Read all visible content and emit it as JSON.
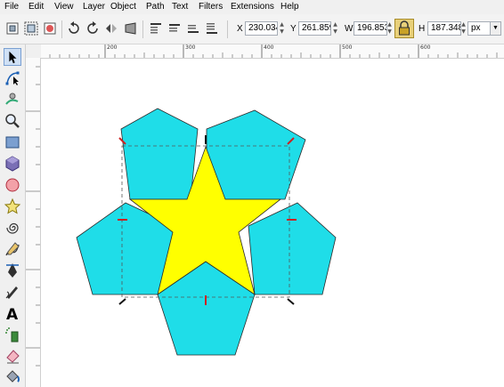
{
  "menu": [
    {
      "label": "File",
      "name": "menu-file"
    },
    {
      "label": "Edit",
      "name": "menu-edit"
    },
    {
      "label": "View",
      "name": "menu-view"
    },
    {
      "label": "Layer",
      "name": "menu-layer"
    },
    {
      "label": "Object",
      "name": "menu-object"
    },
    {
      "label": "Path",
      "name": "menu-path"
    },
    {
      "label": "Text",
      "name": "menu-text"
    },
    {
      "label": "Filters",
      "name": "menu-filters"
    },
    {
      "label": "Extensions",
      "name": "menu-extensions"
    },
    {
      "label": "Help",
      "name": "menu-help"
    }
  ],
  "toolbar": {
    "x_label": "X",
    "x_value": "230.034",
    "y_label": "Y",
    "y_value": "261.859",
    "w_label": "W",
    "w_value": "196.853",
    "h_label": "H",
    "h_value": "187.348",
    "unit": "px",
    "lock_icon": "lock-icon"
  },
  "ruler": {
    "ticks": [
      "200",
      "300",
      "400",
      "500",
      "600"
    ]
  },
  "canvas": {
    "pentagon_color": "#1fdde8",
    "star_color": "#ffff00",
    "handle_color_top": "#cc2222"
  },
  "tools": [
    "selector-arrow-icon",
    "node-tool-icon",
    "tweak-tool-icon",
    "zoom-tool-icon",
    "rectangle-tool-icon",
    "box3d-tool-icon",
    "ellipse-tool-icon",
    "star-tool-icon",
    "spiral-tool-icon",
    "pencil-tool-icon",
    "pen-tool-icon",
    "calligraphy-tool-icon",
    "text-tool-icon",
    "spray-tool-icon",
    "eraser-tool-icon",
    "paint-bucket-icon"
  ]
}
